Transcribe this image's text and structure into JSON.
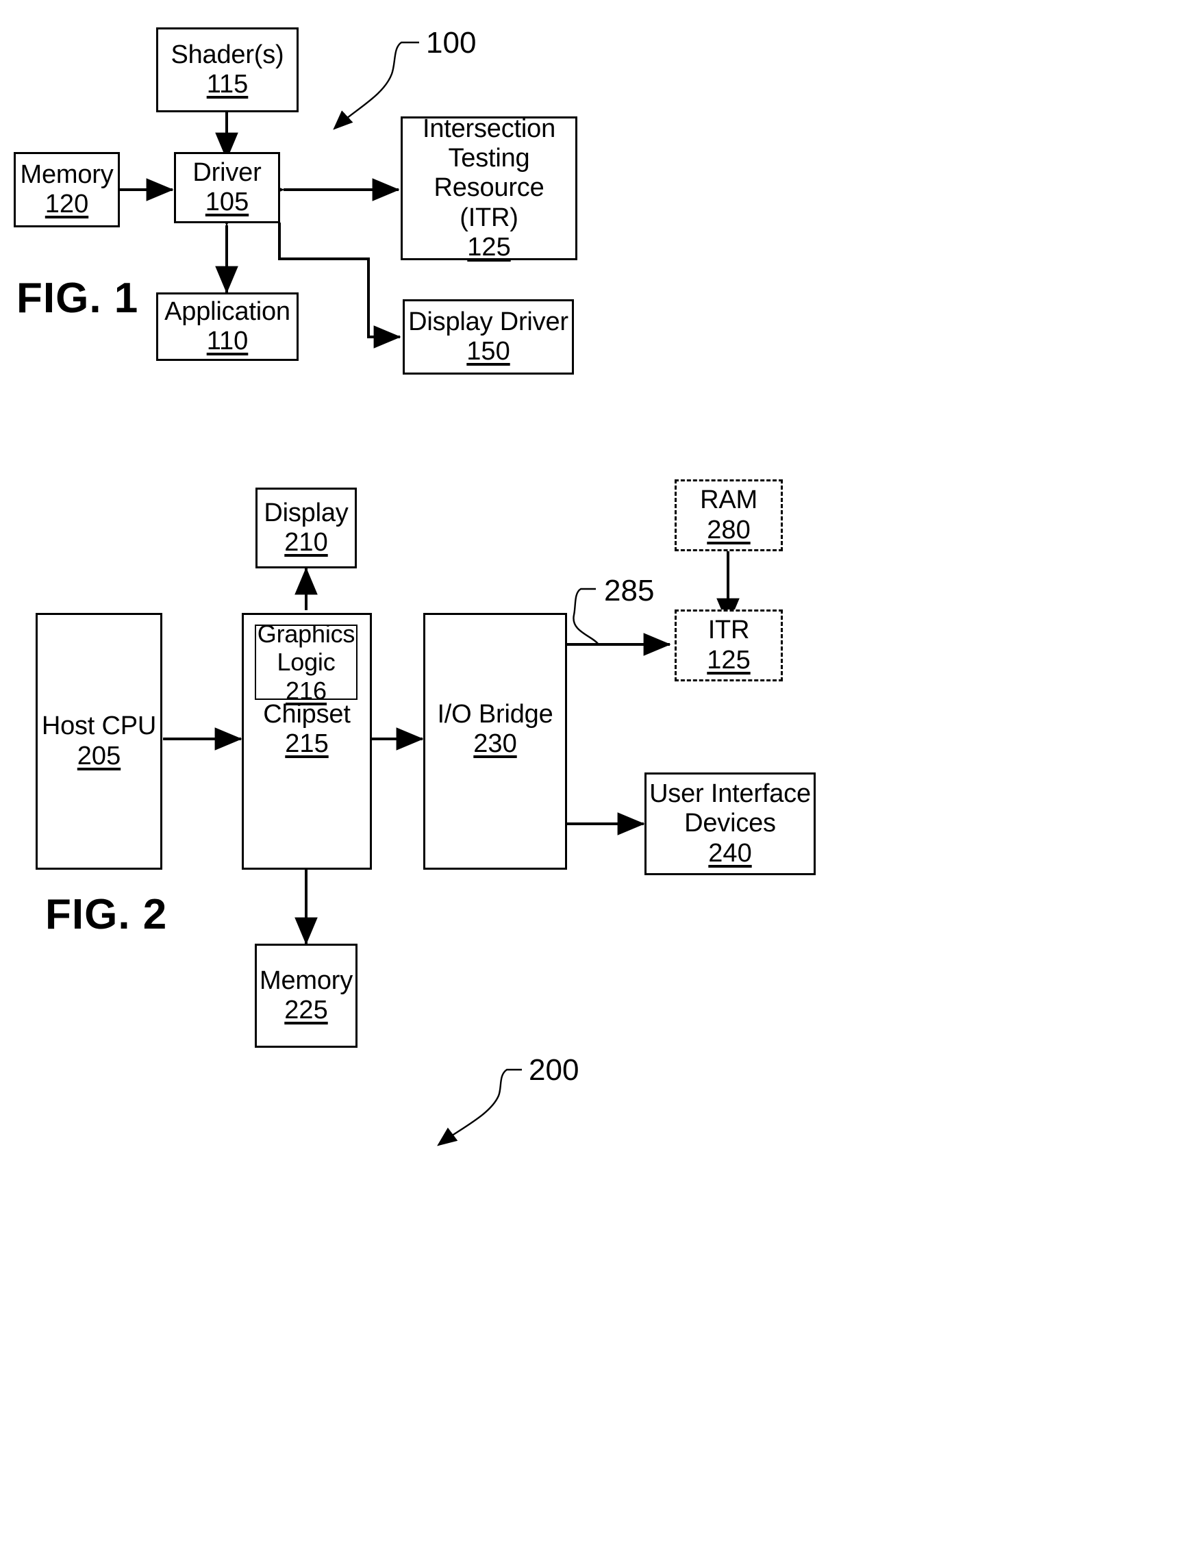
{
  "figures": [
    {
      "id": "fig1",
      "title": "FIG. 1",
      "lead_number": "100",
      "nodes": [
        {
          "key": "shaders",
          "label": "Shader(s)",
          "ref": "115"
        },
        {
          "key": "memory120",
          "label": "Memory",
          "ref": "120"
        },
        {
          "key": "driver",
          "label": "Driver",
          "ref": "105"
        },
        {
          "key": "itr125",
          "label": "Intersection\nTesting\nResource (ITR)",
          "ref": "125"
        },
        {
          "key": "application",
          "label": "Application",
          "ref": "110"
        },
        {
          "key": "display_driver",
          "label": "Display Driver",
          "ref": "150"
        }
      ]
    },
    {
      "id": "fig2",
      "title": "FIG. 2",
      "lead_number": "200",
      "bus_lead_number": "285",
      "nodes": [
        {
          "key": "display210",
          "label": "Display",
          "ref": "210"
        },
        {
          "key": "ram280",
          "label": "RAM",
          "ref": "280"
        },
        {
          "key": "itr125b",
          "label": "ITR",
          "ref": "125"
        },
        {
          "key": "host_cpu",
          "label": "Host CPU",
          "ref": "205"
        },
        {
          "key": "graphics",
          "label": "Graphics\nLogic",
          "ref": "216"
        },
        {
          "key": "chipset",
          "label": "Chipset",
          "ref": "215"
        },
        {
          "key": "io_bridge",
          "label": "I/O Bridge",
          "ref": "230"
        },
        {
          "key": "ui_devices",
          "label": "User Interface\nDevices",
          "ref": "240"
        },
        {
          "key": "memory225",
          "label": "Memory",
          "ref": "225"
        }
      ]
    }
  ],
  "colors": {
    "stroke": "#000000",
    "background": "#ffffff"
  }
}
